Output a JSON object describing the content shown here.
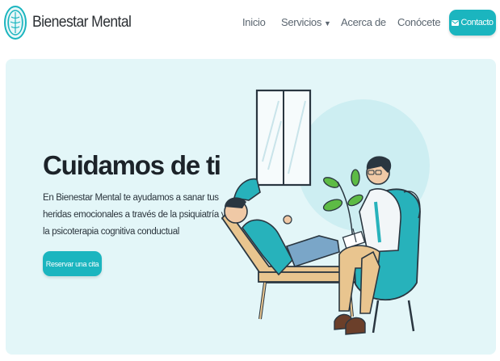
{
  "brand": {
    "name": "Bienestar Mental",
    "logo_icon": "brain-circle-icon"
  },
  "nav": {
    "items": [
      {
        "label": "Inicio"
      },
      {
        "label": "Servicios",
        "has_dropdown": true,
        "dropdown_icon": "caret-down-icon"
      },
      {
        "label": "Acerca de"
      },
      {
        "label": "Conócete"
      }
    ],
    "contact_button": {
      "label": "Contacto",
      "icon": "mail-icon"
    }
  },
  "hero": {
    "title": "Cuidamos de ti",
    "description": "En Bienestar Mental te ayudamos a sanar tus heridas emocionales a través de la psiquiatría y la psicoterapia cognitiva conductual",
    "cta_label": "Reservar una cita",
    "illustration": "therapy-session-illustration"
  },
  "colors": {
    "accent": "#1bb5bf",
    "hero_background": "#e3f6f8",
    "accent_dark": "#138c95",
    "text_dark": "#1c2329"
  }
}
